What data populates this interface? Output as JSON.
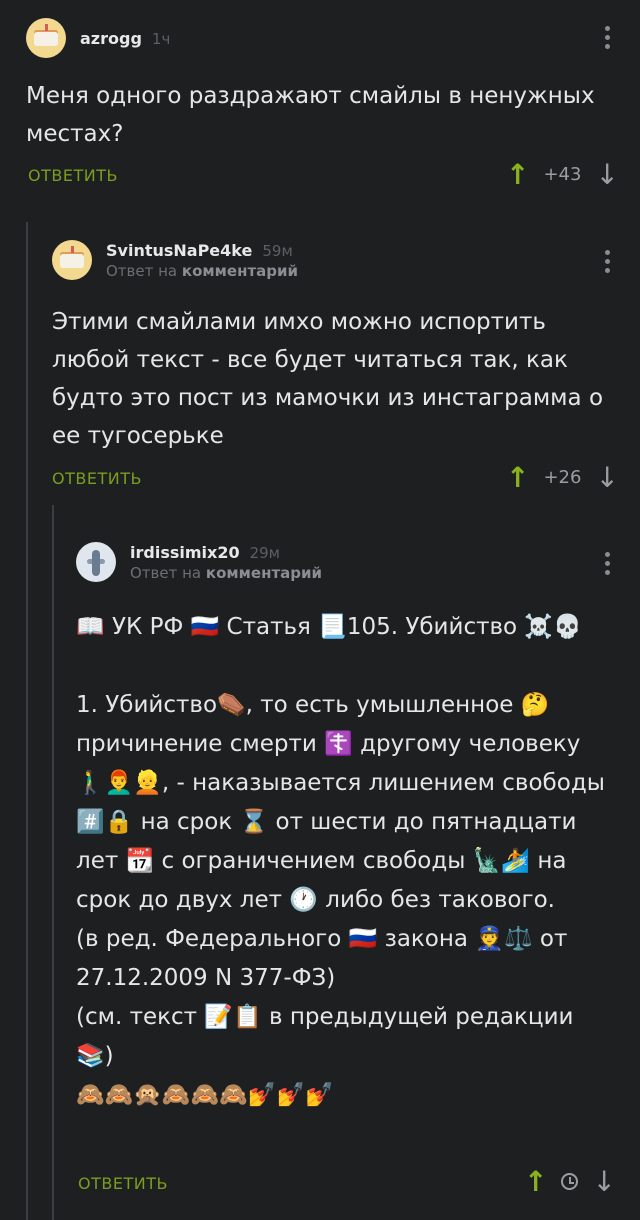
{
  "comments": [
    {
      "username": "azrogg",
      "time": "1ч",
      "text": "Меня одного раздражают смайлы в ненужных местах?",
      "reply_label": "ОТВЕТИТЬ",
      "rating": "+43",
      "avatar_icon": "cake-avatar"
    },
    {
      "username": "SvintusNaPe4ke",
      "time": "59м",
      "reply_prefix": "Ответ на",
      "reply_target": "комментарий",
      "text": "Этими смайлами имхо можно испортить любой текст - все будет читаться так, как будто это пост из мамочки из инстаграмма о ее тугосерьке",
      "reply_label": "ОТВЕТИТЬ",
      "rating": "+26",
      "avatar_icon": "cake-avatar"
    },
    {
      "username": "irdissimix20",
      "time": "29м",
      "reply_prefix": "Ответ на",
      "reply_target": "комментарий",
      "text": "📖 УК РФ 🇷🇺 Статья 📃105. Убийство ☠️💀\n\n1. Убийство⚰️, то есть умышленное 🤔 причинение смерти ☦️ другому человеку 🚶‍♂️👨‍🦰👱, - наказывается лишением свободы #️⃣🔒 на срок ⌛ от шести до пятнадцати лет 📆 с ограничением свободы 🗽🏄 на срок до двух лет 🕐 либо без такового.\n(в ред. Федерального 🇷🇺 закона 👮⚖️ от 27.12.2009 N 377-ФЗ)\n(см. текст 📝📋 в предыдущей редакции 📚)\n🙈🙈🙊🙈🙈🙈💅💅💅",
      "reply_label": "ОТВЕТИТЬ",
      "avatar_icon": "photo-avatar"
    }
  ]
}
